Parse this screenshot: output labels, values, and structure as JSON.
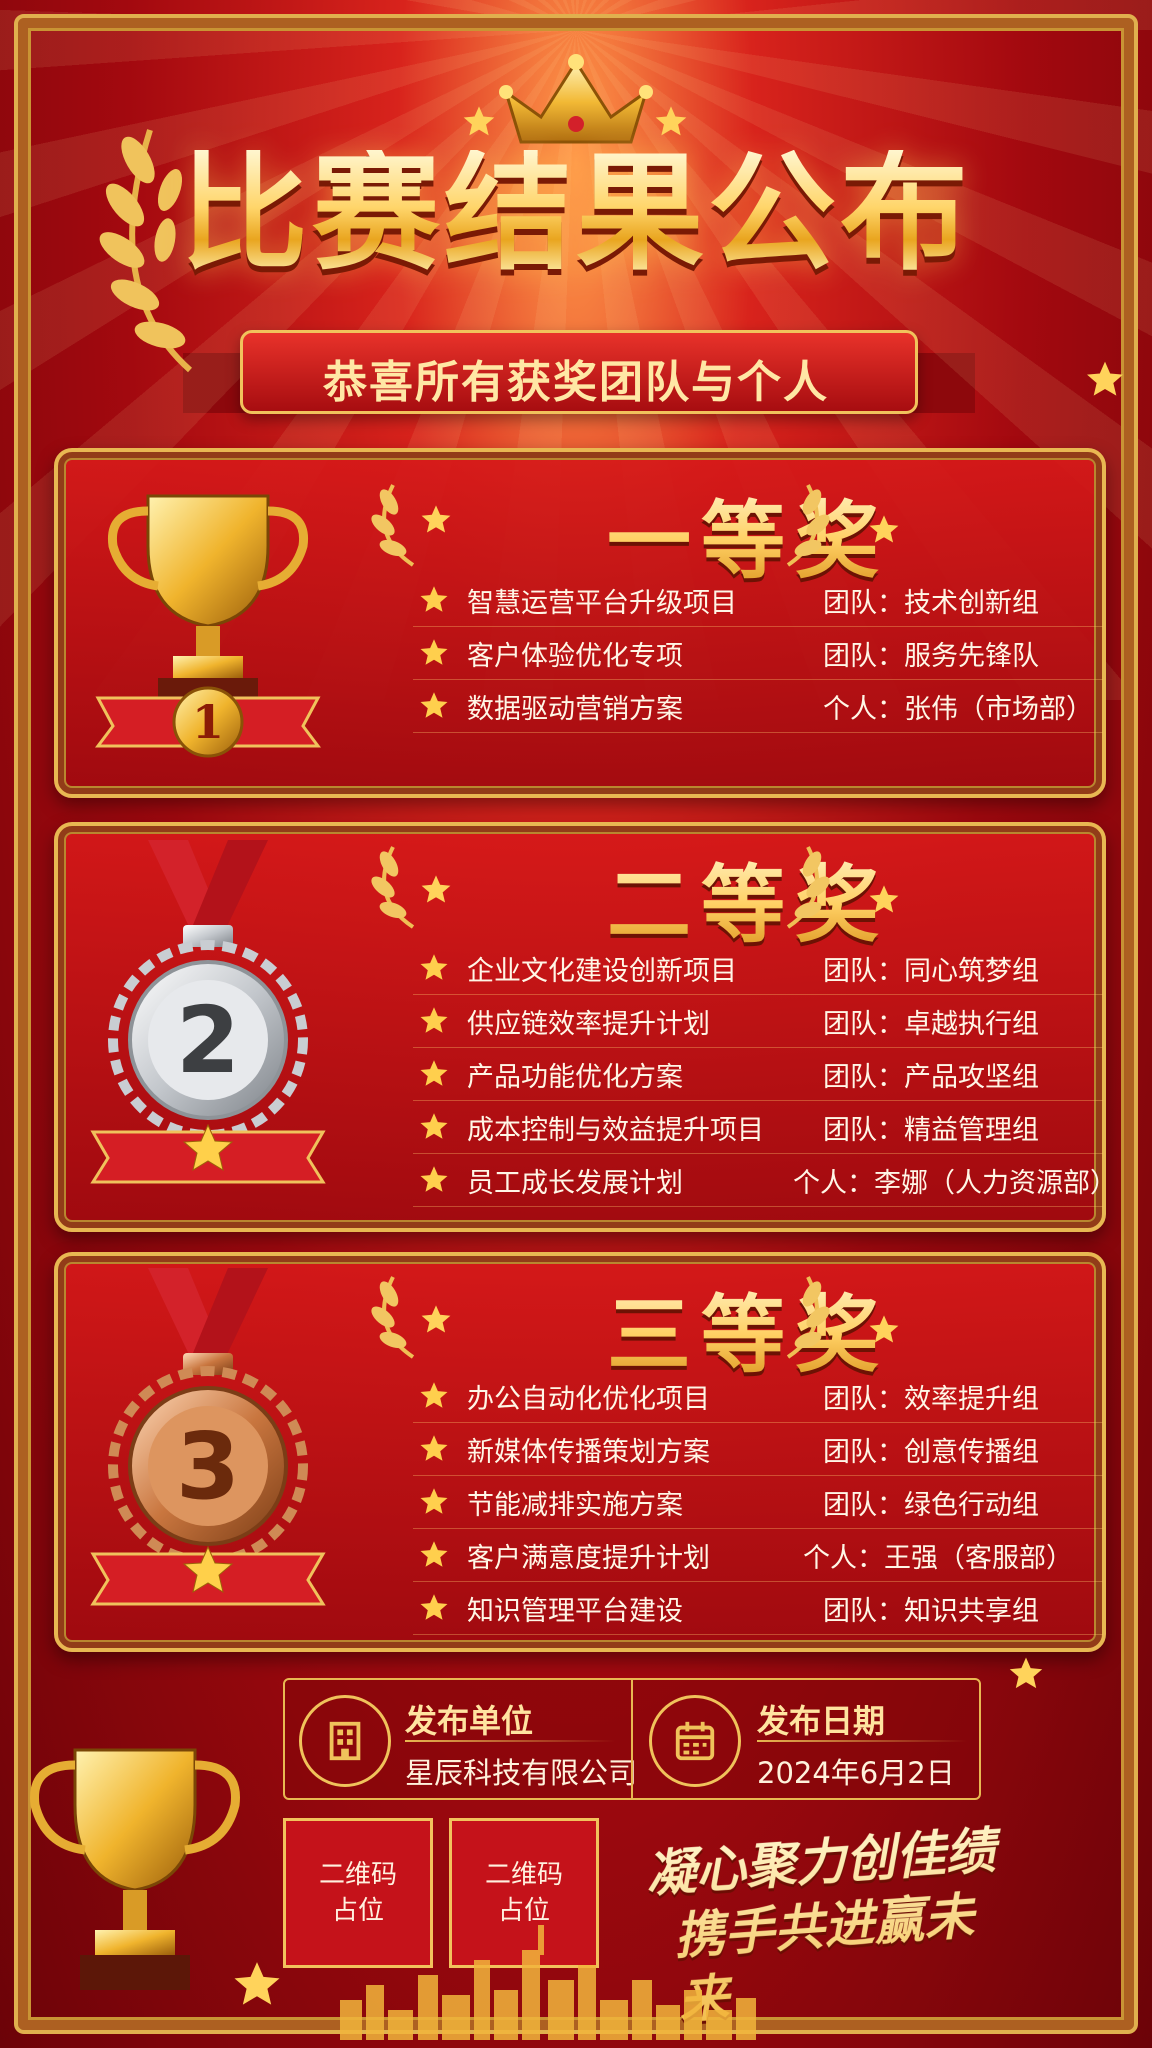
{
  "header": {
    "title": "比赛结果公布",
    "subtitle": "恭喜所有获奖团队与个人"
  },
  "awards": [
    {
      "title": "一等奖",
      "medal_number": "1",
      "rows": [
        {
          "project": "智慧运营平台升级项目",
          "winner": "团队：技术创新组"
        },
        {
          "project": "客户体验优化专项",
          "winner": "团队：服务先锋队"
        },
        {
          "project": "数据驱动营销方案",
          "winner": "个人：张伟（市场部）"
        }
      ]
    },
    {
      "title": "二等奖",
      "medal_number": "2",
      "rows": [
        {
          "project": "企业文化建设创新项目",
          "winner": "团队：同心筑梦组"
        },
        {
          "project": "供应链效率提升计划",
          "winner": "团队：卓越执行组"
        },
        {
          "project": "产品功能优化方案",
          "winner": "团队：产品攻坚组"
        },
        {
          "project": "成本控制与效益提升项目",
          "winner": "团队：精益管理组"
        },
        {
          "project": "员工成长发展计划",
          "winner": "个人：李娜（人力资源部）"
        }
      ]
    },
    {
      "title": "三等奖",
      "medal_number": "3",
      "rows": [
        {
          "project": "办公自动化优化项目",
          "winner": "团队：效率提升组"
        },
        {
          "project": "新媒体传播策划方案",
          "winner": "团队：创意传播组"
        },
        {
          "project": "节能减排实施方案",
          "winner": "团队：绿色行动组"
        },
        {
          "project": "客户满意度提升计划",
          "winner": "个人：王强（客服部）"
        },
        {
          "project": "知识管理平台建设",
          "winner": "团队：知识共享组"
        }
      ]
    }
  ],
  "footer": {
    "publisher_label": "发布单位",
    "publisher_value": "星辰科技有限公司",
    "date_label": "发布日期",
    "date_value": "2024年6月2日",
    "qr1": "二维码占位",
    "qr2": "二维码占位",
    "slogan_line1": "凝心聚力创佳绩",
    "slogan_line2": "携手共进赢未来"
  },
  "icons": {
    "crown": "crown-icon",
    "trophy": "trophy-icon",
    "medal": "medal-icon",
    "star": "star-icon",
    "laurel": "laurel-icon",
    "building": "building-icon",
    "calendar": "calendar-icon"
  },
  "colors": {
    "background_red": "#b3101a",
    "gold": "#e8b852",
    "silver": "#c9cdd2",
    "bronze": "#c9763f"
  }
}
